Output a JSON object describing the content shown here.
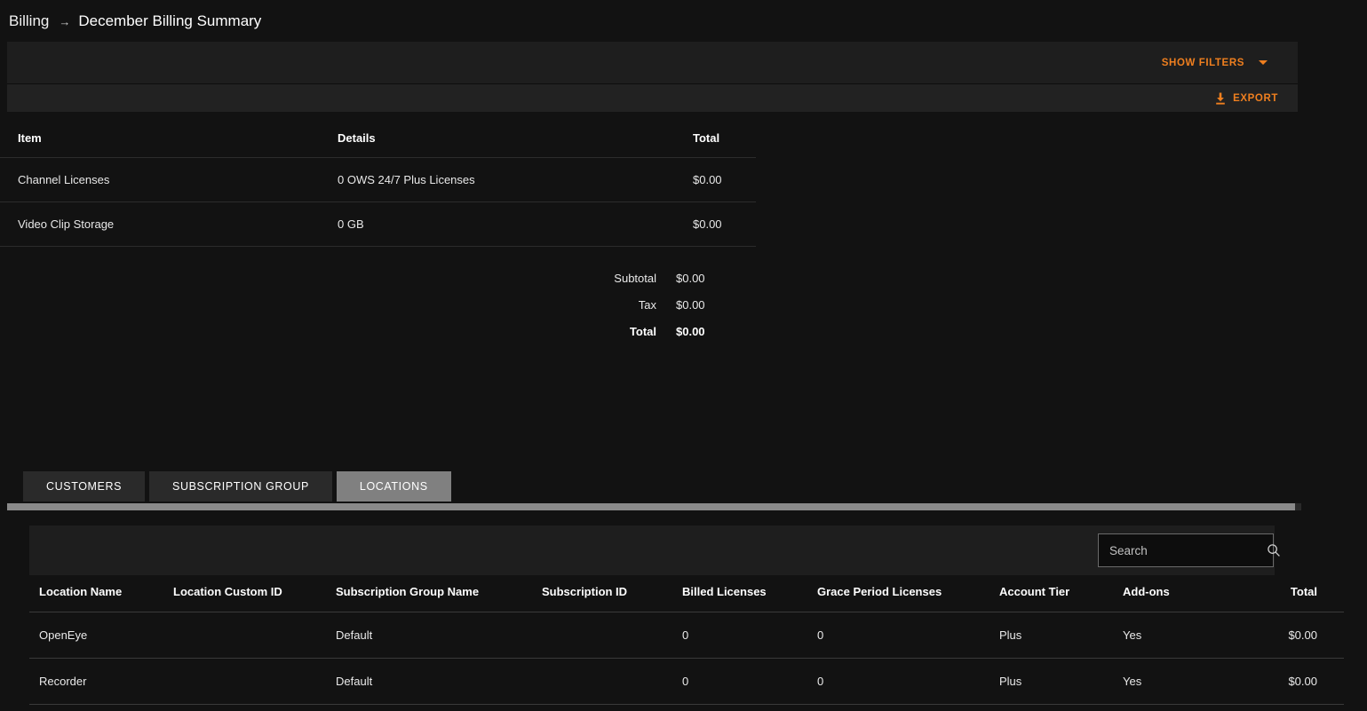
{
  "breadcrumb": {
    "root": "Billing",
    "separator": "→",
    "current": "December Billing Summary"
  },
  "toolbar": {
    "show_filters_label": "SHOW FILTERS",
    "export_label": "EXPORT",
    "accent_color": "#ef7f1f"
  },
  "summary": {
    "columns": [
      "Item",
      "Details",
      "Total"
    ],
    "rows": [
      {
        "item": "Channel Licenses",
        "details": "0 OWS 24/7 Plus Licenses",
        "total": "$0.00"
      },
      {
        "item": "Video Clip Storage",
        "details": "0 GB",
        "total": "$0.00"
      }
    ],
    "totals": [
      {
        "label": "Subtotal",
        "value": "$0.00"
      },
      {
        "label": "Tax",
        "value": "$0.00"
      },
      {
        "label": "Total",
        "value": "$0.00"
      }
    ]
  },
  "tabs": {
    "items": [
      {
        "label": "CUSTOMERS",
        "active": false
      },
      {
        "label": "SUBSCRIPTION GROUP",
        "active": false
      },
      {
        "label": "LOCATIONS",
        "active": true
      }
    ]
  },
  "search": {
    "value": "",
    "placeholder": "Search",
    "icon": "search-icon"
  },
  "locations": {
    "columns": [
      "Location Name",
      "Location Custom ID",
      "Subscription Group Name",
      "Subscription ID",
      "Billed Licenses",
      "Grace Period Licenses",
      "Account Tier",
      "Add-ons",
      "Total"
    ],
    "rows": [
      {
        "location_name": "OpenEye",
        "location_custom_id": "",
        "subscription_group_name": "Default",
        "subscription_id": "",
        "billed_licenses": "0",
        "grace_period_licenses": "0",
        "account_tier": "Plus",
        "addons": "Yes",
        "total": "$0.00"
      },
      {
        "location_name": "Recorder",
        "location_custom_id": "",
        "subscription_group_name": "Default",
        "subscription_id": "",
        "billed_licenses": "0",
        "grace_period_licenses": "0",
        "account_tier": "Plus",
        "addons": "Yes",
        "total": "$0.00"
      }
    ]
  }
}
